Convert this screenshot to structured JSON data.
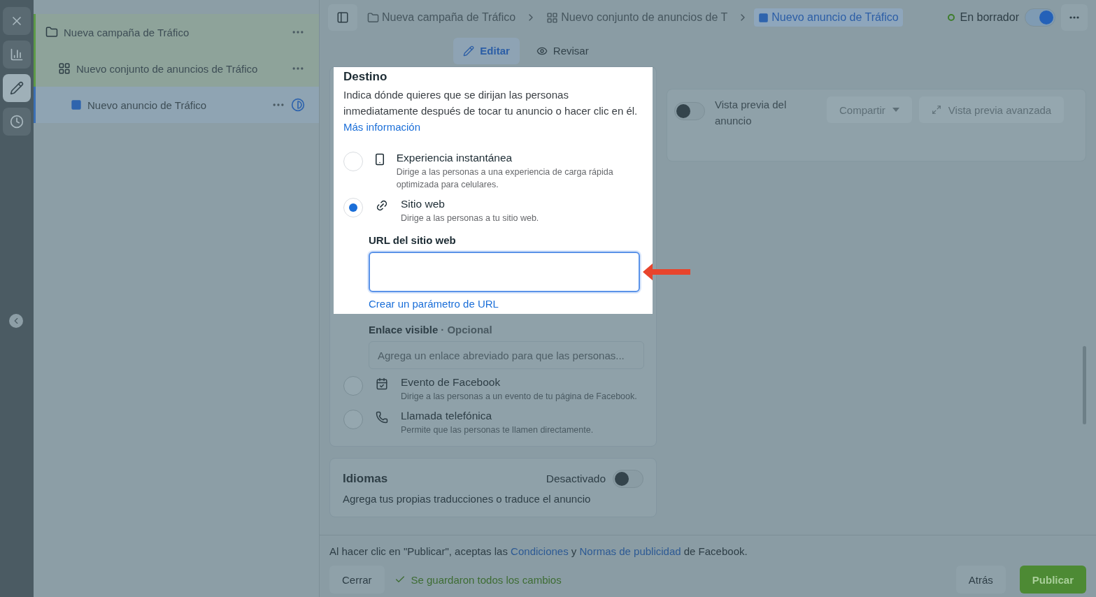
{
  "rail": [
    {
      "kind": "close",
      "selected": false
    },
    {
      "kind": "chart",
      "selected": false
    },
    {
      "kind": "edit",
      "selected": true
    },
    {
      "kind": "history",
      "selected": false
    }
  ],
  "tree": [
    {
      "label": "Nueva campaña de Tráfico",
      "kind": "campaign",
      "selected": false,
      "children": [
        {
          "label": "Nuevo conjunto de anuncios de Tráfico",
          "kind": "adset",
          "selected": false,
          "children": [
            {
              "label": "Nuevo anuncio de Tráfico",
              "kind": "ad",
              "selected": true
            }
          ]
        }
      ]
    }
  ],
  "breadcrumb": [
    {
      "label": "Nueva campaña de Tráfico",
      "kind": "campaign",
      "selected": false
    },
    {
      "label": "Nuevo conjunto de anuncios de T",
      "kind": "adset",
      "selected": false
    },
    {
      "label": "Nuevo anuncio de Tráfico",
      "kind": "ad",
      "selected": true
    }
  ],
  "status": {
    "label": "En borrador",
    "on": true
  },
  "modes": [
    {
      "label": "Editar",
      "kind": "edit",
      "selected": true
    },
    {
      "label": "Revisar",
      "kind": "review",
      "selected": false
    }
  ],
  "destination": {
    "title": "Destino",
    "description": "Indica dónde quieres que se dirijan las personas inmediatamente después de tocar tu anuncio o hacer clic en él.",
    "link": "Más información",
    "options": [
      {
        "kind": "instant",
        "title": "Experiencia instantánea",
        "description": "Dirige a las personas a una experiencia de carga rápida optimizada para celulares.",
        "selected": false
      },
      {
        "kind": "website",
        "title": "Sitio web",
        "description": "Dirige a las personas a tu sitio web.",
        "selected": true
      },
      {
        "kind": "event",
        "title": "Evento de Facebook",
        "description": "Dirige a las personas a un evento de tu página de Facebook.",
        "selected": false
      },
      {
        "kind": "phone",
        "title": "Llamada telefónica",
        "description": "Permite que las personas te llamen directamente.",
        "selected": false
      }
    ],
    "url_field": {
      "label": "URL del sitio web",
      "highlighted": true,
      "link": "Crear un parámetro de URL"
    },
    "display_link": {
      "label": "Enlace visible",
      "optional": "· Opcional",
      "placeholder": "Agrega un enlace abreviado para que las personas..."
    }
  },
  "languages": {
    "title": "Idiomas",
    "toggle_label": "Desactivado",
    "on": false,
    "description": "Agrega tus propias traducciones o traduce el anuncio"
  },
  "preview": {
    "label": "Vista previa del anuncio",
    "on": false,
    "share": "Compartir",
    "advanced": "Vista previa avanzada"
  },
  "footer": {
    "terms_before": "Al hacer clic en \"Publicar\", aceptas las",
    "terms_link1": "Condiciones",
    "terms_middle": "y",
    "terms_link2": "Normas de publicidad",
    "terms_after": "de Facebook.",
    "close": "Cerrar",
    "saved": "Se guardaron todos los cambios",
    "back": "Atrás",
    "publish": "Publicar"
  }
}
